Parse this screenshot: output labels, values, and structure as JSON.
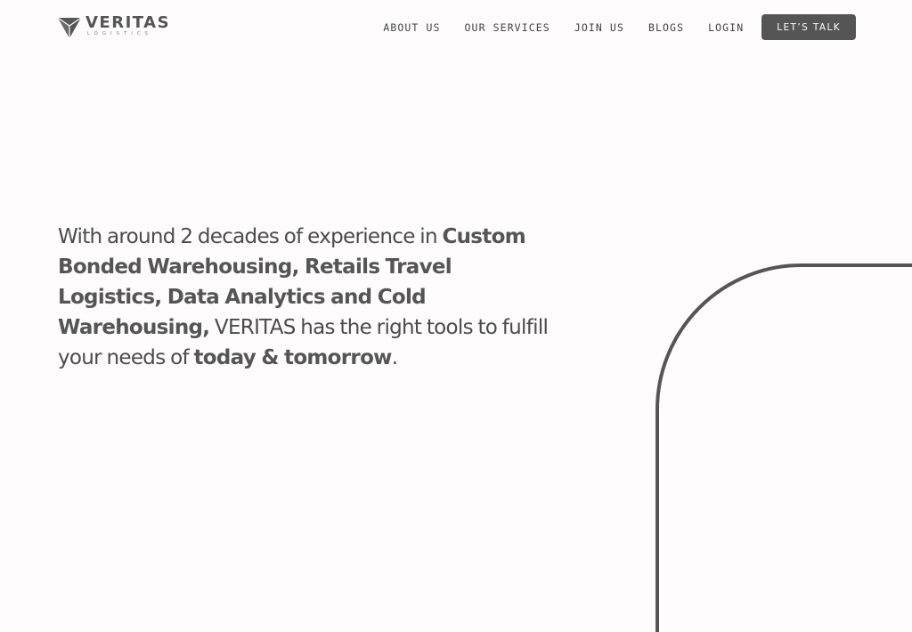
{
  "brand": {
    "name": "VERITAS",
    "tagline": "LOGISTICS",
    "logo_icon": "triangle-logo-icon",
    "color": "#555555"
  },
  "nav": {
    "items": [
      {
        "label": "ABOUT US"
      },
      {
        "label": "OUR SERVICES"
      },
      {
        "label": "JOIN US"
      },
      {
        "label": "BLOGS"
      },
      {
        "label": "LOGIN"
      }
    ],
    "cta_label": "LET’S TALK"
  },
  "hero": {
    "part1": "With around 2 decades of experience in ",
    "highlight1": "Custom Bonded Warehousing, Retails Travel Logistics, Data Analytics and Cold Warehousing,",
    "part2": " VERITAS has the right tools to fulfill your needs of ",
    "highlight2": "today & tomorrow",
    "part3": "."
  },
  "colors": {
    "background": "#fefcfc",
    "accent": "#555555",
    "text": "#4b4b4b"
  }
}
